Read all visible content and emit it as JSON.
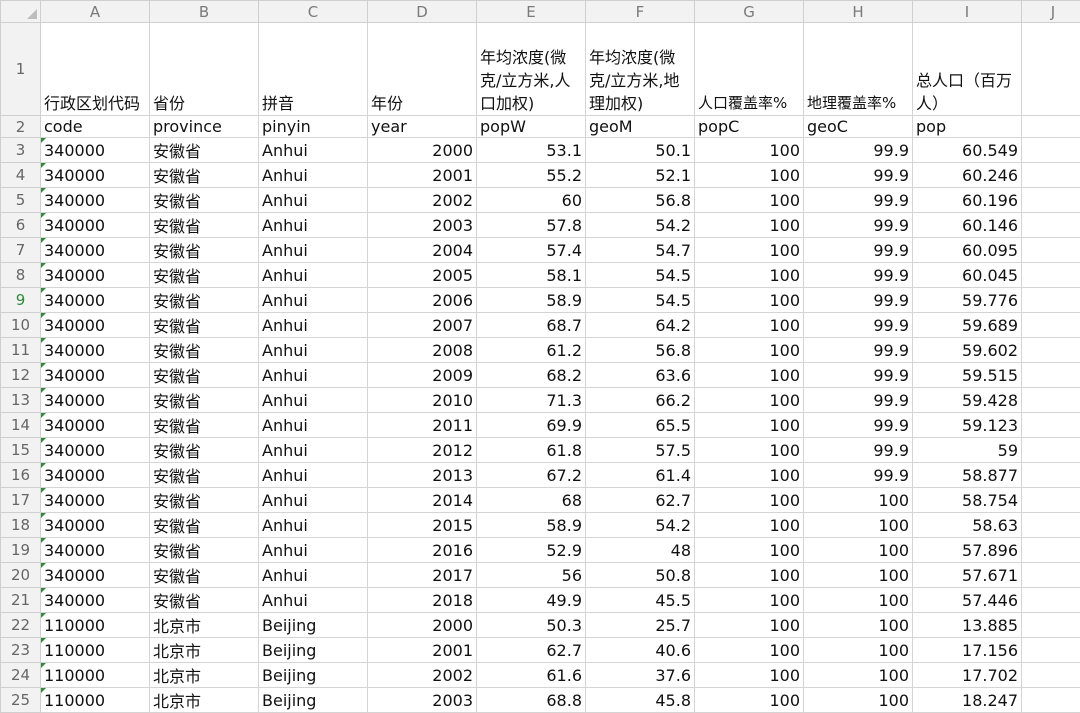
{
  "columns": [
    "A",
    "B",
    "C",
    "D",
    "E",
    "F",
    "G",
    "H",
    "I",
    "J"
  ],
  "header_cn": [
    "行政区划代码",
    "省份",
    "拼音",
    "年份",
    "年均浓度(微克/立方米,人口加权)",
    "年均浓度(微克/立方米,地理加权)",
    "人口覆盖率%",
    "地理覆盖率%",
    "总人口（百万人）"
  ],
  "header_en": [
    "code",
    "province",
    "pinyin",
    "year",
    "popW",
    "geoM",
    "popC",
    "geoC",
    "pop"
  ],
  "rows": [
    [
      "340000",
      "安徽省",
      "Anhui",
      "2000",
      "53.1",
      "50.1",
      "100",
      "99.9",
      "60.549"
    ],
    [
      "340000",
      "安徽省",
      "Anhui",
      "2001",
      "55.2",
      "52.1",
      "100",
      "99.9",
      "60.246"
    ],
    [
      "340000",
      "安徽省",
      "Anhui",
      "2002",
      "60",
      "56.8",
      "100",
      "99.9",
      "60.196"
    ],
    [
      "340000",
      "安徽省",
      "Anhui",
      "2003",
      "57.8",
      "54.2",
      "100",
      "99.9",
      "60.146"
    ],
    [
      "340000",
      "安徽省",
      "Anhui",
      "2004",
      "57.4",
      "54.7",
      "100",
      "99.9",
      "60.095"
    ],
    [
      "340000",
      "安徽省",
      "Anhui",
      "2005",
      "58.1",
      "54.5",
      "100",
      "99.9",
      "60.045"
    ],
    [
      "340000",
      "安徽省",
      "Anhui",
      "2006",
      "58.9",
      "54.5",
      "100",
      "99.9",
      "59.776"
    ],
    [
      "340000",
      "安徽省",
      "Anhui",
      "2007",
      "68.7",
      "64.2",
      "100",
      "99.9",
      "59.689"
    ],
    [
      "340000",
      "安徽省",
      "Anhui",
      "2008",
      "61.2",
      "56.8",
      "100",
      "99.9",
      "59.602"
    ],
    [
      "340000",
      "安徽省",
      "Anhui",
      "2009",
      "68.2",
      "63.6",
      "100",
      "99.9",
      "59.515"
    ],
    [
      "340000",
      "安徽省",
      "Anhui",
      "2010",
      "71.3",
      "66.2",
      "100",
      "99.9",
      "59.428"
    ],
    [
      "340000",
      "安徽省",
      "Anhui",
      "2011",
      "69.9",
      "65.5",
      "100",
      "99.9",
      "59.123"
    ],
    [
      "340000",
      "安徽省",
      "Anhui",
      "2012",
      "61.8",
      "57.5",
      "100",
      "99.9",
      "59"
    ],
    [
      "340000",
      "安徽省",
      "Anhui",
      "2013",
      "67.2",
      "61.4",
      "100",
      "99.9",
      "58.877"
    ],
    [
      "340000",
      "安徽省",
      "Anhui",
      "2014",
      "68",
      "62.7",
      "100",
      "100",
      "58.754"
    ],
    [
      "340000",
      "安徽省",
      "Anhui",
      "2015",
      "58.9",
      "54.2",
      "100",
      "100",
      "58.63"
    ],
    [
      "340000",
      "安徽省",
      "Anhui",
      "2016",
      "52.9",
      "48",
      "100",
      "100",
      "57.896"
    ],
    [
      "340000",
      "安徽省",
      "Anhui",
      "2017",
      "56",
      "50.8",
      "100",
      "100",
      "57.671"
    ],
    [
      "340000",
      "安徽省",
      "Anhui",
      "2018",
      "49.9",
      "45.5",
      "100",
      "100",
      "57.446"
    ],
    [
      "110000",
      "北京市",
      "Beijing",
      "2000",
      "50.3",
      "25.7",
      "100",
      "100",
      "13.885"
    ],
    [
      "110000",
      "北京市",
      "Beijing",
      "2001",
      "62.7",
      "40.6",
      "100",
      "100",
      "17.156"
    ],
    [
      "110000",
      "北京市",
      "Beijing",
      "2002",
      "61.6",
      "37.6",
      "100",
      "100",
      "17.702"
    ],
    [
      "110000",
      "北京市",
      "Beijing",
      "2003",
      "68.8",
      "45.8",
      "100",
      "100",
      "18.247"
    ]
  ],
  "row_numbers": [
    "1",
    "2",
    "3",
    "4",
    "5",
    "6",
    "7",
    "8",
    "9",
    "10",
    "11",
    "12",
    "13",
    "14",
    "15",
    "16",
    "17",
    "18",
    "19",
    "20",
    "21",
    "22",
    "23",
    "24",
    "25"
  ],
  "selected_row": "9",
  "colors": {
    "header_bg": "#f2f2f2",
    "grid": "#d4d4d4",
    "selection_green": "#2e8b3a"
  }
}
